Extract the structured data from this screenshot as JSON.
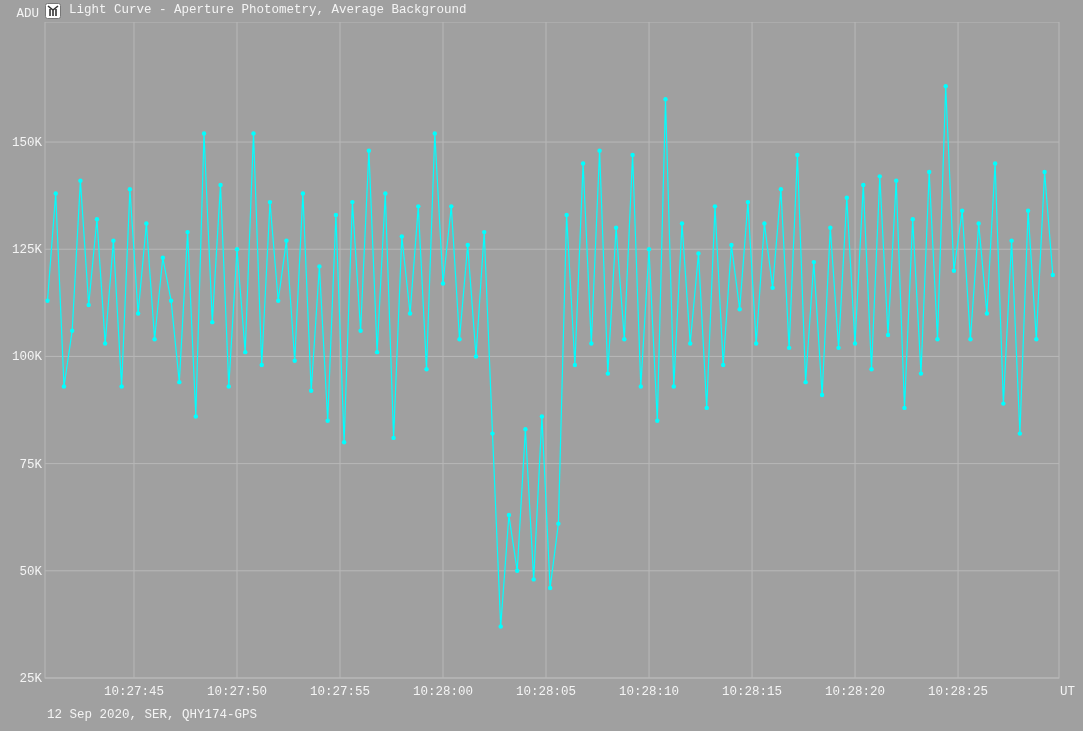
{
  "window": {
    "title": "Light Curve - Aperture Photometry, Average Background"
  },
  "chart": {
    "chart_data": {
      "type": "line",
      "grid": true,
      "ylabel": "ADU",
      "xlabel": "UT",
      "xlim": [
        37660.68,
        37709.9
      ],
      "ylim": [
        25,
        178
      ],
      "xticks": [
        {
          "value": 37665,
          "label": "10:27:45"
        },
        {
          "value": 37670,
          "label": "10:27:50"
        },
        {
          "value": 37675,
          "label": "10:27:55"
        },
        {
          "value": 37680,
          "label": "10:28:00"
        },
        {
          "value": 37685,
          "label": "10:28:05"
        },
        {
          "value": 37690,
          "label": "10:28:10"
        },
        {
          "value": 37695,
          "label": "10:28:15"
        },
        {
          "value": 37700,
          "label": "10:28:20"
        },
        {
          "value": 37705,
          "label": "10:28:25"
        }
      ],
      "yticks": [
        {
          "value": 25,
          "label": "25K"
        },
        {
          "value": 50,
          "label": "50K"
        },
        {
          "value": 75,
          "label": "75K"
        },
        {
          "value": 100,
          "label": "100K"
        },
        {
          "value": 125,
          "label": "125K"
        },
        {
          "value": 150,
          "label": "150K"
        }
      ],
      "x": [
        37660.8,
        37661.2,
        37661.6,
        37662.0,
        37662.4,
        37662.8,
        37663.2,
        37663.6,
        37664.0,
        37664.4,
        37664.8,
        37665.2,
        37665.6,
        37666.0,
        37666.4,
        37666.8,
        37667.2,
        37667.6,
        37668.0,
        37668.4,
        37668.8,
        37669.2,
        37669.6,
        37670.0,
        37670.4,
        37670.8,
        37671.2,
        37671.6,
        37672.0,
        37672.4,
        37672.8,
        37673.2,
        37673.6,
        37674.0,
        37674.4,
        37674.8,
        37675.2,
        37675.6,
        37676.0,
        37676.4,
        37676.8,
        37677.2,
        37677.6,
        37678.0,
        37678.4,
        37678.8,
        37679.2,
        37679.6,
        37680.0,
        37680.4,
        37680.8,
        37681.2,
        37681.6,
        37682.0,
        37682.4,
        37682.8,
        37683.2,
        37683.6,
        37684.0,
        37684.4,
        37684.8,
        37685.2,
        37685.6,
        37686.0,
        37686.4,
        37686.8,
        37687.2,
        37687.6,
        37688.0,
        37688.4,
        37688.8,
        37689.2,
        37689.6,
        37690.0,
        37690.4,
        37690.8,
        37691.2,
        37691.6,
        37692.0,
        37692.4,
        37692.8,
        37693.2,
        37693.6,
        37694.0,
        37694.4,
        37694.8,
        37695.2,
        37695.6,
        37696.0,
        37696.4,
        37696.8,
        37697.2,
        37697.6,
        37698.0,
        37698.4,
        37698.8,
        37699.2,
        37699.6,
        37700.0,
        37700.4,
        37700.8,
        37701.2,
        37701.6,
        37702.0,
        37702.4,
        37702.8,
        37703.2,
        37703.6,
        37704.0,
        37704.4,
        37704.8,
        37705.2,
        37705.6,
        37706.0,
        37706.4,
        37706.8,
        37707.2,
        37707.6,
        37708.0,
        37708.4,
        37708.8,
        37709.2,
        37709.6
      ],
      "series": [
        {
          "color": "#00ffff",
          "values": [
            113,
            138,
            93,
            106,
            141,
            112,
            132,
            103,
            127,
            93,
            139,
            110,
            131,
            104,
            123,
            113,
            94,
            129,
            86,
            152,
            108,
            140,
            93,
            125,
            101,
            152,
            98,
            136,
            113,
            127,
            99,
            138,
            92,
            121,
            85,
            133,
            80,
            136,
            106,
            148,
            101,
            138,
            81,
            128,
            110,
            135,
            97,
            152,
            117,
            135,
            104,
            126,
            100,
            129,
            82,
            37,
            63,
            50,
            83,
            48,
            86,
            46,
            61,
            133,
            98,
            145,
            103,
            148,
            96,
            130,
            104,
            147,
            93,
            125,
            85,
            160,
            93,
            131,
            103,
            124,
            88,
            135,
            98,
            126,
            111,
            136,
            103,
            131,
            116,
            139,
            102,
            147,
            94,
            122,
            91,
            130,
            102,
            137,
            103,
            140,
            97,
            142,
            105,
            141,
            88,
            132,
            96,
            143,
            104,
            163,
            120,
            134,
            104,
            131,
            110,
            145,
            89,
            127,
            82,
            134,
            104,
            143,
            119
          ]
        }
      ]
    }
  },
  "footer": {
    "text": "12 Sep 2020, SER, QHY174-GPS"
  }
}
